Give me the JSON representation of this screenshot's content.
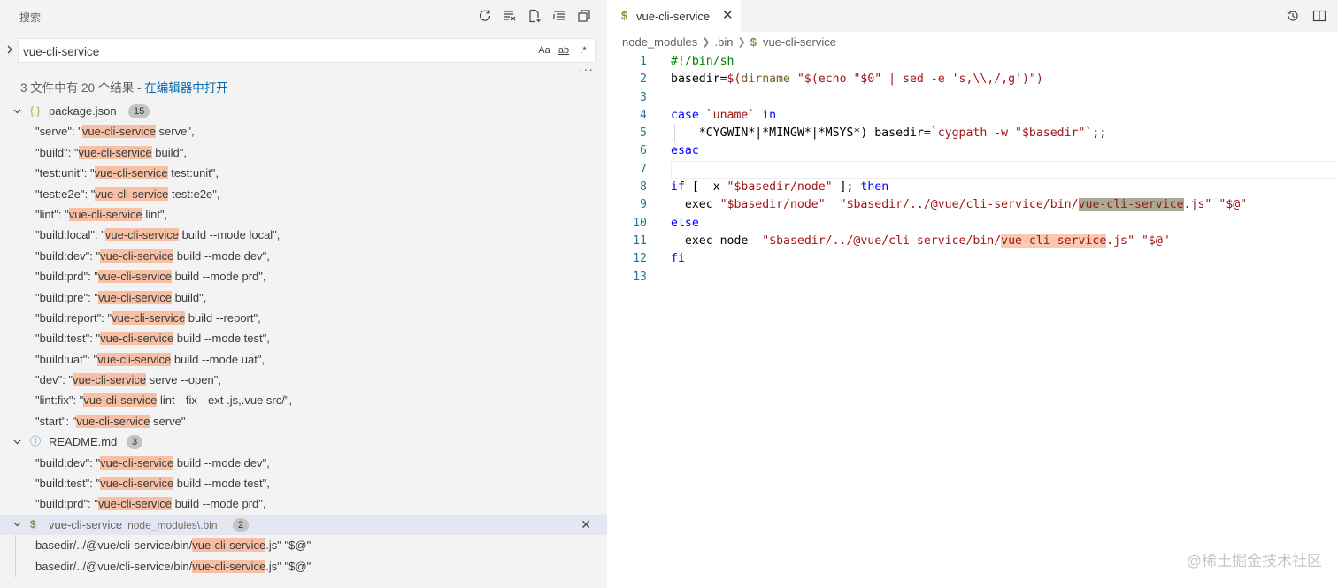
{
  "search_panel": {
    "title": "搜索",
    "actions": [
      "refresh-icon",
      "clear-results-icon",
      "new-search-editor-icon",
      "collapse-all-icon",
      "view-as-tree-icon"
    ],
    "query": "vue-cli-service",
    "options": {
      "match_case": "Aa",
      "whole_word": "ab",
      "regex": ".*"
    },
    "more": "···",
    "summary_prefix": "3 文件中有 20 个结果 - ",
    "summary_link": "在编辑器中打开",
    "files": [
      {
        "name": "package.json",
        "icon": "{ }",
        "count": "15",
        "matches": [
          {
            "pre": "\"serve\": \"",
            "hit": "vue-cli-service",
            "post": " serve\","
          },
          {
            "pre": "\"build\": \"",
            "hit": "vue-cli-service",
            "post": " build\","
          },
          {
            "pre": "\"test:unit\": \"",
            "hit": "vue-cli-service",
            "post": " test:unit\","
          },
          {
            "pre": "\"test:e2e\": \"",
            "hit": "vue-cli-service",
            "post": " test:e2e\","
          },
          {
            "pre": "\"lint\": \"",
            "hit": "vue-cli-service",
            "post": " lint\","
          },
          {
            "pre": "\"build:local\": \"",
            "hit": "vue-cli-service",
            "post": " build --mode local\","
          },
          {
            "pre": "\"build:dev\": \"",
            "hit": "vue-cli-service",
            "post": " build --mode dev\","
          },
          {
            "pre": "\"build:prd\": \"",
            "hit": "vue-cli-service",
            "post": " build --mode prd\","
          },
          {
            "pre": "\"build:pre\": \"",
            "hit": "vue-cli-service",
            "post": " build\","
          },
          {
            "pre": "\"build:report\": \"",
            "hit": "vue-cli-service",
            "post": " build --report\","
          },
          {
            "pre": "\"build:test\": \"",
            "hit": "vue-cli-service",
            "post": " build --mode test\","
          },
          {
            "pre": "\"build:uat\": \"",
            "hit": "vue-cli-service",
            "post": " build --mode uat\","
          },
          {
            "pre": "\"dev\": \"",
            "hit": "vue-cli-service",
            "post": " serve --open\","
          },
          {
            "pre": "\"lint:fix\": \"",
            "hit": "vue-cli-service",
            "post": " lint --fix --ext .js,.vue src/\","
          },
          {
            "pre": "\"start\": \"",
            "hit": "vue-cli-service",
            "post": " serve\""
          }
        ]
      },
      {
        "name": "README.md",
        "icon": "ⓘ",
        "count": "3",
        "matches": [
          {
            "pre": "\"build:dev\": \"",
            "hit": "vue-cli-service",
            "post": " build --mode dev\","
          },
          {
            "pre": "\"build:test\": \"",
            "hit": "vue-cli-service",
            "post": " build --mode test\","
          },
          {
            "pre": "\"build:prd\": \"",
            "hit": "vue-cli-service",
            "post": " build --mode prd\","
          }
        ]
      },
      {
        "name": "vue-cli-service",
        "dir": "node_modules\\.bin",
        "icon": "$",
        "count": "2",
        "selected": true,
        "matches": [
          {
            "pre": "basedir/../@vue/cli-service/bin/",
            "hit": "vue-cli-service",
            "post": ".js\" \"$@\""
          },
          {
            "pre": "basedir/../@vue/cli-service/bin/",
            "hit": "vue-cli-service",
            "post": ".js\" \"$@\""
          }
        ]
      }
    ]
  },
  "editor": {
    "tab": {
      "icon": "$",
      "label": "vue-cli-service",
      "close": "✕"
    },
    "tab_actions": [
      "history-icon",
      "split-editor-icon"
    ],
    "breadcrumb": [
      "node_modules",
      ".bin",
      "vue-cli-service"
    ],
    "lines": [
      {
        "n": "1",
        "segs": [
          {
            "t": "#!/bin/sh",
            "c": "tok-comment"
          }
        ]
      },
      {
        "n": "2",
        "segs": [
          {
            "t": "basedir=",
            "c": "tok-op"
          },
          {
            "t": "$(",
            "c": "tok-str"
          },
          {
            "t": "dirname",
            "c": "tok-fn"
          },
          {
            "t": " \"$(echo \"$0\" | sed -e 's,\\\\,/,g')\")",
            "c": "tok-str"
          }
        ]
      },
      {
        "n": "3",
        "segs": []
      },
      {
        "n": "4",
        "segs": [
          {
            "t": "case",
            "c": "tok-kw"
          },
          {
            "t": " `uname` ",
            "c": "tok-str"
          },
          {
            "t": "in",
            "c": "tok-kw"
          }
        ]
      },
      {
        "n": "5",
        "guide": true,
        "segs": [
          {
            "t": "    *CYGWIN*|*MINGW*|*MSYS*) basedir=",
            "c": "tok-op"
          },
          {
            "t": "`cygpath -w \"$basedir\"`",
            "c": "tok-str"
          },
          {
            "t": ";;",
            "c": "tok-op"
          }
        ]
      },
      {
        "n": "6",
        "segs": [
          {
            "t": "esac",
            "c": "tok-kw"
          }
        ]
      },
      {
        "n": "7",
        "current": true,
        "segs": []
      },
      {
        "n": "8",
        "segs": [
          {
            "t": "if",
            "c": "tok-kw"
          },
          {
            "t": " [ -x ",
            "c": "tok-op"
          },
          {
            "t": "\"$basedir/node\"",
            "c": "tok-str"
          },
          {
            "t": " ]; ",
            "c": "tok-op"
          },
          {
            "t": "then",
            "c": "tok-kw"
          }
        ]
      },
      {
        "n": "9",
        "segs": [
          {
            "t": "  exec ",
            "c": "tok-op"
          },
          {
            "t": "\"$basedir/node\"",
            "c": "tok-str"
          },
          {
            "t": "  ",
            "c": "tok-op"
          },
          {
            "t": "\"$basedir/../@vue/cli-service/bin/",
            "c": "tok-str"
          },
          {
            "t": "vue-cli-service",
            "c": "tok-str hl-active"
          },
          {
            "t": ".js\"",
            "c": "tok-str"
          },
          {
            "t": " ",
            "c": "tok-op"
          },
          {
            "t": "\"$@\"",
            "c": "tok-str"
          }
        ]
      },
      {
        "n": "10",
        "segs": [
          {
            "t": "else",
            "c": "tok-kw"
          }
        ]
      },
      {
        "n": "11",
        "segs": [
          {
            "t": "  exec node  ",
            "c": "tok-op"
          },
          {
            "t": "\"$basedir/../@vue/cli-service/bin/",
            "c": "tok-str"
          },
          {
            "t": "vue-cli-service",
            "c": "tok-str hl-code"
          },
          {
            "t": ".js\"",
            "c": "tok-str"
          },
          {
            "t": " ",
            "c": "tok-op"
          },
          {
            "t": "\"$@\"",
            "c": "tok-str"
          }
        ]
      },
      {
        "n": "12",
        "segs": [
          {
            "t": "fi",
            "c": "tok-kw"
          }
        ]
      },
      {
        "n": "13",
        "segs": []
      }
    ]
  },
  "watermark": "@稀土掘金技术社区"
}
